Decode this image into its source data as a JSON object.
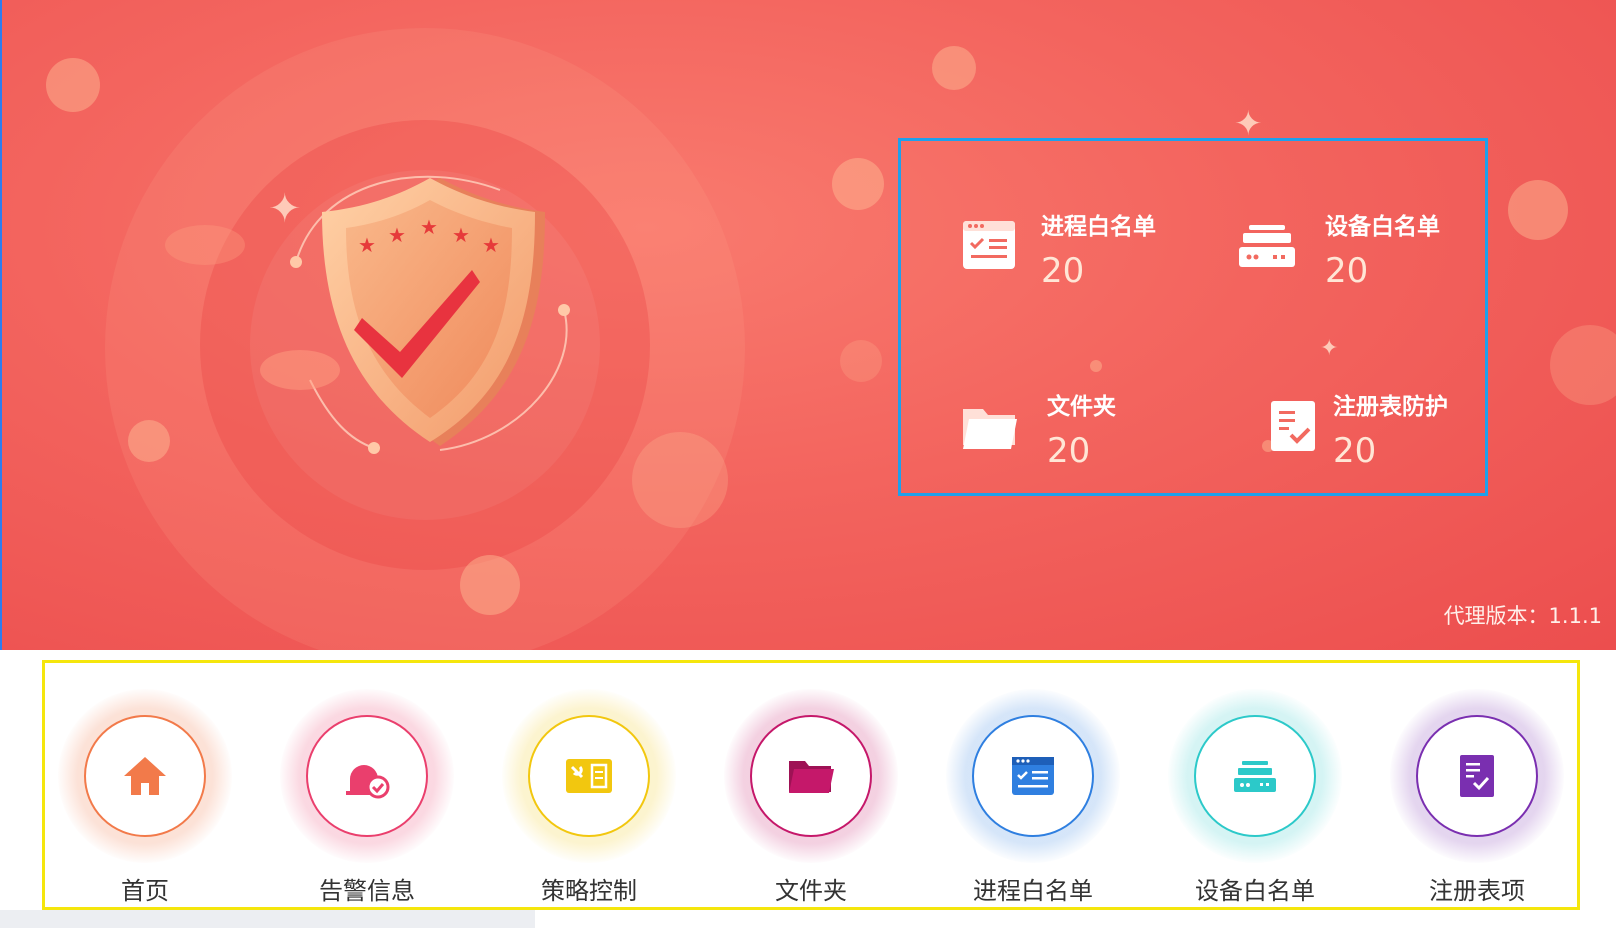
{
  "colors": {
    "hero_bg": "#f3645e",
    "stats_border": "#1ea0ec",
    "nav_border": "#f5e60c"
  },
  "stats": [
    {
      "label": "进程白名单",
      "value": "20",
      "icon": "process-list-icon"
    },
    {
      "label": "设备白名单",
      "value": "20",
      "icon": "device-icon"
    },
    {
      "label": "文件夹",
      "value": "20",
      "icon": "folder-icon"
    },
    {
      "label": "注册表防护",
      "value": "20",
      "icon": "registry-check-icon"
    }
  ],
  "version": "代理版本：1.1.1",
  "nav": [
    {
      "label": "首页",
      "icon": "home-icon",
      "color": "#f27a4a"
    },
    {
      "label": "告警信息",
      "icon": "alarm-icon",
      "color": "#ea3f6d"
    },
    {
      "label": "策略控制",
      "icon": "policy-icon",
      "color": "#f2c70f"
    },
    {
      "label": "文件夹",
      "icon": "folder-icon",
      "color": "#c5186a"
    },
    {
      "label": "进程白名单",
      "icon": "process-list-icon",
      "color": "#2f7fe0"
    },
    {
      "label": "设备白名单",
      "icon": "device-icon",
      "color": "#2cc9c9"
    },
    {
      "label": "注册表项",
      "icon": "registry-check-icon",
      "color": "#7a2fb0"
    }
  ]
}
